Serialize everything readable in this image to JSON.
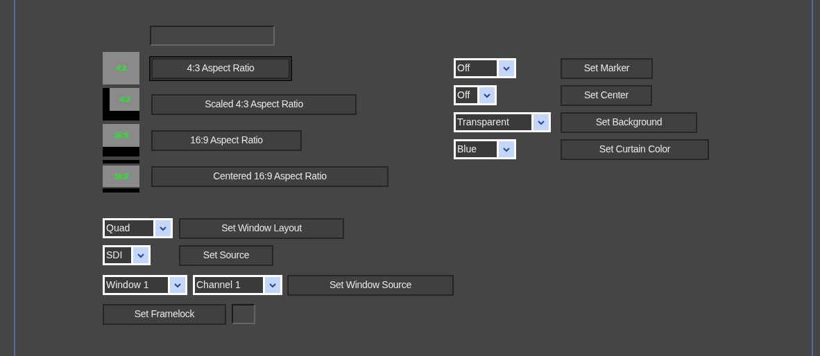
{
  "aspect_ratios": [
    {
      "kind": "full",
      "icon_label": "4:3",
      "button": "4:3 Aspect Ratio",
      "focused": true
    },
    {
      "kind": "scaled",
      "icon_label": "4:3",
      "button": "Scaled 4:3 Aspect Ratio",
      "focused": false
    },
    {
      "kind": "letterbox",
      "icon_label": "16:9",
      "button": "16:9 Aspect Ratio",
      "focused": false
    },
    {
      "kind": "centered",
      "icon_label": "16:9",
      "button": "Centered 16:9 Aspect Ratio",
      "focused": false
    }
  ],
  "window_controls": [
    {
      "selects": [
        "Quad"
      ],
      "button": "Set Window Layout"
    },
    {
      "selects": [
        "SDI"
      ],
      "button": "Set Source"
    },
    {
      "selects": [
        "Window 1",
        "Channel 1"
      ],
      "button": "Set Window Source"
    },
    {
      "button": "Set Framelock",
      "checkbox": {
        "checked": false
      }
    }
  ],
  "display_settings": [
    {
      "select": "Off",
      "button": "Set Marker"
    },
    {
      "select": "Off",
      "button": "Set Center"
    },
    {
      "select": "Transparent",
      "button": "Set Background"
    },
    {
      "select": "Blue",
      "button": "Set Curtain Color"
    }
  ]
}
